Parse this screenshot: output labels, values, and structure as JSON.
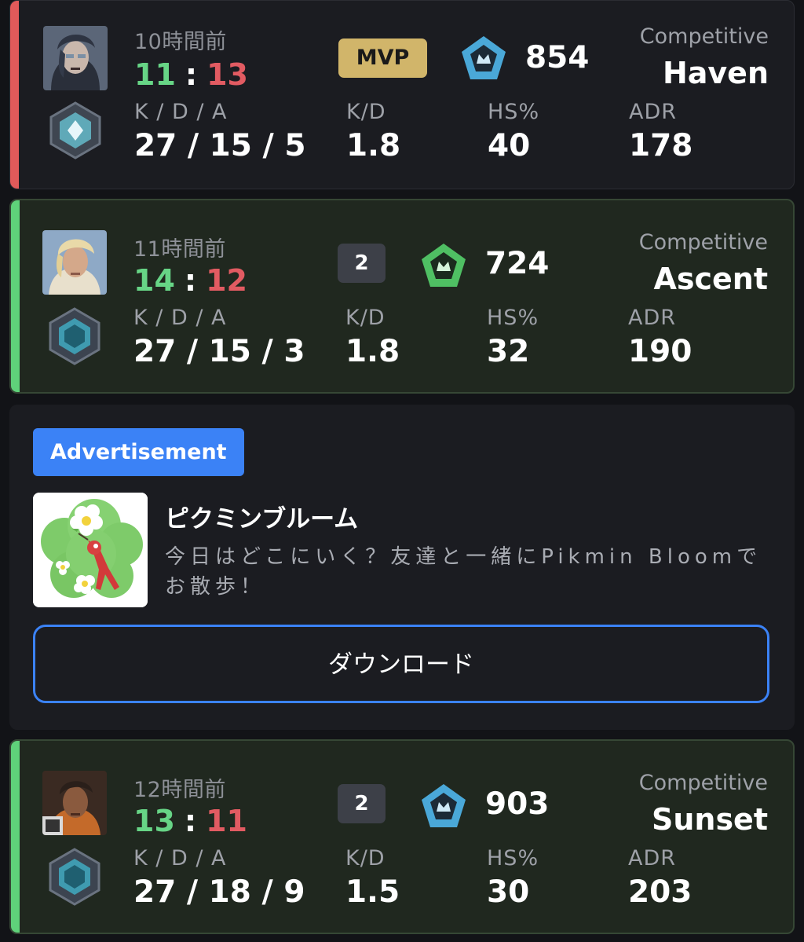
{
  "matches": [
    {
      "time": "10時間前",
      "score_team": "11",
      "score_sep": ":",
      "score_enemy": "13",
      "badge": "MVP",
      "rr": "854",
      "mode": "Competitive",
      "map": "Haven",
      "kda_label": "K / D / A",
      "kda": "27 / 15 / 5",
      "kd_label": "K/D",
      "kd": "1.8",
      "hs_label": "HS%",
      "hs": "40",
      "adr_label": "ADR",
      "adr": "178",
      "result_color": "#e05a5a"
    },
    {
      "time": "11時間前",
      "score_team": "14",
      "score_sep": ":",
      "score_enemy": "12",
      "badge": "2",
      "rr": "724",
      "mode": "Competitive",
      "map": "Ascent",
      "kda_label": "K / D / A",
      "kda": "27 / 15 / 3",
      "kd_label": "K/D",
      "kd": "1.8",
      "hs_label": "HS%",
      "hs": "32",
      "adr_label": "ADR",
      "adr": "190",
      "result_color": "#5fd27a"
    },
    {
      "time": "12時間前",
      "score_team": "13",
      "score_sep": ":",
      "score_enemy": "11",
      "badge": "2",
      "rr": "903",
      "mode": "Competitive",
      "map": "Sunset",
      "kda_label": "K / D / A",
      "kda": "27 / 18 / 9",
      "kd_label": "K/D",
      "kd": "1.5",
      "hs_label": "HS%",
      "hs": "30",
      "adr_label": "ADR",
      "adr": "203",
      "result_color": "#5fd27a"
    }
  ],
  "ad": {
    "badge": "Advertisement",
    "title": "ピクミンブルーム",
    "description": "今日はどこにいく？友達と一緒にPikmin Bloomでお散歩！",
    "button": "ダウンロード",
    "accent": "#3b82f6"
  },
  "icons": {
    "agent_avatar": "agent-portrait-icon",
    "rank": "rank-emblem-icon",
    "rr_emblem": "pentagon-rank-icon",
    "ad_icon": "pikmin-bloom-app-icon"
  }
}
